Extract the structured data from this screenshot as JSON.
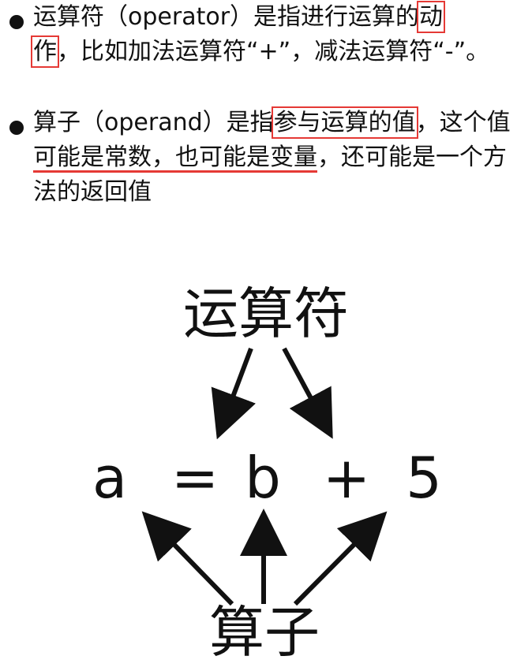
{
  "bullets": [
    {
      "text_a": "运算符（operator）是指进行运算的",
      "boxed_1": "动",
      "boxed_2": "作",
      "text_b": "，比如加法运算符“+”，减法运算符“-”。"
    },
    {
      "text_a": "算子（operand）是指",
      "boxed": "参与运算的值",
      "text_b": "，这个值",
      "underlined": "可能是常数，也可能是变量",
      "text_c": "，还可能是一个方法的返回值"
    }
  ],
  "diagram": {
    "operator_label": "运算符",
    "operand_label": "算子",
    "expression": [
      "a",
      "=",
      "b",
      "+",
      "5"
    ]
  },
  "colors": {
    "highlight": "#e53935",
    "text": "#111111"
  }
}
